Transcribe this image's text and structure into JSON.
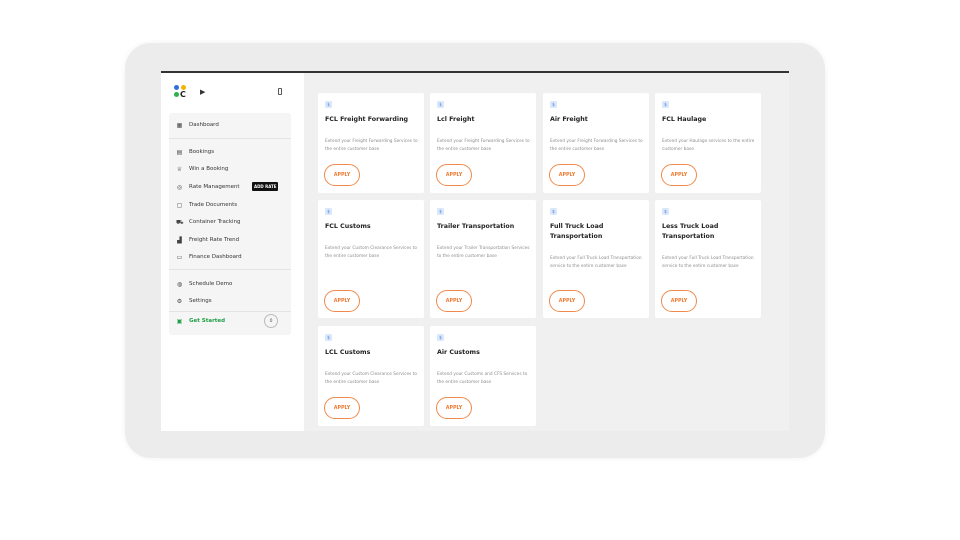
{
  "sidebar": {
    "logo_letter": "C",
    "cursor_glyph": "▶",
    "items": [
      {
        "label": "Dashboard",
        "icon": "dashboard-icon",
        "glyph": "▦"
      },
      {
        "label": "Bookings",
        "icon": "bookings-icon",
        "glyph": "▤"
      },
      {
        "label": "Win a Booking",
        "icon": "trophy-icon",
        "glyph": "♕"
      },
      {
        "label": "Rate Management",
        "icon": "search-rate-icon",
        "glyph": "◎"
      },
      {
        "label": "Trade Documents",
        "icon": "document-icon",
        "glyph": "▢"
      },
      {
        "label": "Container Tracking",
        "icon": "truck-icon",
        "glyph": "⛟"
      },
      {
        "label": "Freight Rate Trend",
        "icon": "chart-icon",
        "glyph": "▟"
      },
      {
        "label": "Finance Dashboard",
        "icon": "wallet-icon",
        "glyph": "▭"
      },
      {
        "label": "Schedule Demo",
        "icon": "headset-icon",
        "glyph": "◍"
      },
      {
        "label": "Settings",
        "icon": "gear-icon",
        "glyph": "⚙"
      },
      {
        "label": "Get Started",
        "icon": "calendar-icon",
        "glyph": "▣"
      }
    ],
    "add_rate_badge": "ADD RATE",
    "progress_value": "0"
  },
  "cards": [
    {
      "badge": "$",
      "title": "FCL Freight Forwarding",
      "description": "Extend your Freight Forwarding Services to the entire customer base",
      "button": "APPLY"
    },
    {
      "badge": "$",
      "title": "Lcl Freight",
      "description": "Extend your Freight Forwarding Services to the entire customer base",
      "button": "APPLY"
    },
    {
      "badge": "$",
      "title": "Air Freight",
      "description": "Extend your Freight Forwarding Services to the entire customer base",
      "button": "APPLY"
    },
    {
      "badge": "$",
      "title": "FCL Haulage",
      "description": "Extend your Haulage services to the entire customer base",
      "button": "APPLY"
    },
    {
      "badge": "$",
      "title": "FCL Customs",
      "description": "Extend your Custom Clearance Services to the entire customer base",
      "button": "APPLY"
    },
    {
      "badge": "$",
      "title": "Trailer Transportation",
      "description": "Extend your Trailer Transportation Services to the entire customer base",
      "button": "APPLY"
    },
    {
      "badge": "$",
      "title": "Full Truck Load Transportation",
      "description": "Extend your Full Truck Load Transportation service to the entire customer base",
      "button": "APPLY"
    },
    {
      "badge": "$",
      "title": "Less Truck Load Transportation",
      "description": "Extend your Full Truck Load Transportation service to the entire customer base",
      "button": "APPLY"
    },
    {
      "badge": "$",
      "title": "LCL Customs",
      "description": "Extend your Custom Clearance Services to the entire customer base",
      "button": "APPLY"
    },
    {
      "badge": "$",
      "title": "Air Customs",
      "description": "Extend your Customs and CFS Services to the entire customer base",
      "button": "APPLY"
    }
  ],
  "colors": {
    "accent_orange": "#f07a33",
    "chat_button": "#2b25e8",
    "get_started_green": "#1f9d45"
  }
}
